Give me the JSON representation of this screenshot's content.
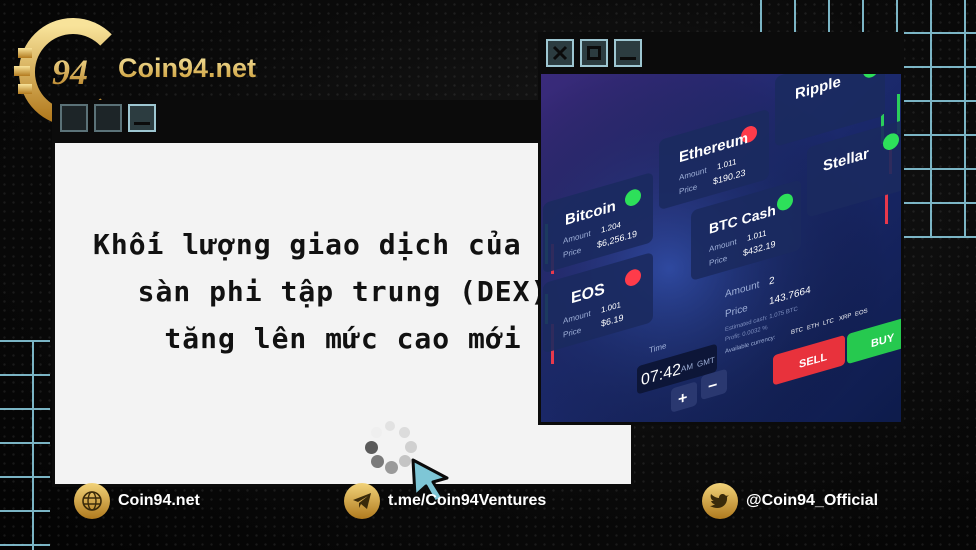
{
  "brand": {
    "name": "Coin94.net",
    "mark": "94"
  },
  "headline": {
    "line1": "Khối lượng giao dịch của các",
    "line2_pre": "sàn ",
    "line2_em": "phi tập trung (DEX)",
    "line3_em": "tăng lên",
    "line3_post": " mức cao mới"
  },
  "photo": {
    "cards": [
      {
        "name": "Bitcoin",
        "amount_label": "Amount",
        "amount": "1.204",
        "price_label": "Price",
        "price": "$6,256.19",
        "status_color": "#2de05a"
      },
      {
        "name": "Ethereum",
        "amount_label": "Amount",
        "amount": "1.011",
        "price_label": "Price",
        "price": "$190.23",
        "status_color": "#ff3b4a"
      },
      {
        "name": "Ripple",
        "status_color": "#2de05a"
      },
      {
        "name": "EOS",
        "amount_label": "Amount",
        "amount": "1.001",
        "price_label": "Price",
        "price": "$6.19",
        "status_color": "#ff3b4a"
      },
      {
        "name": "BTC Cash",
        "amount_label": "Amount",
        "amount": "1.011",
        "price_label": "Price",
        "price": "$432.19",
        "status_color": "#2de05a"
      },
      {
        "name": "Stellar",
        "status_color": "#2de05a"
      }
    ],
    "trade": {
      "amount_label": "Amount",
      "amount": "2",
      "price_label": "Price",
      "price": "143.7664",
      "est_cash": "Estimated cash: 1.075 BTC",
      "profit": "Profit: 0.0032 %",
      "currency_label": "Available currency:",
      "currencies": [
        "BTC",
        "ETH",
        "LTC",
        "XRP",
        "EOS"
      ],
      "time_label": "Time",
      "time": "07:42",
      "ampm": "AM",
      "tz": "GMT",
      "plus": "+",
      "minus": "−",
      "sell_label": "SELL",
      "buy_label": "BUY"
    }
  },
  "footer": {
    "website": "Coin94.net",
    "telegram": "t.me/Coin94Ventures",
    "twitter": "@Coin94_Official"
  },
  "colors": {
    "gold": "#d9a63a",
    "grid": "#8fd3e6",
    "card": "#f3f3f3",
    "sell": "#e8323c",
    "buy": "#26c94f"
  }
}
